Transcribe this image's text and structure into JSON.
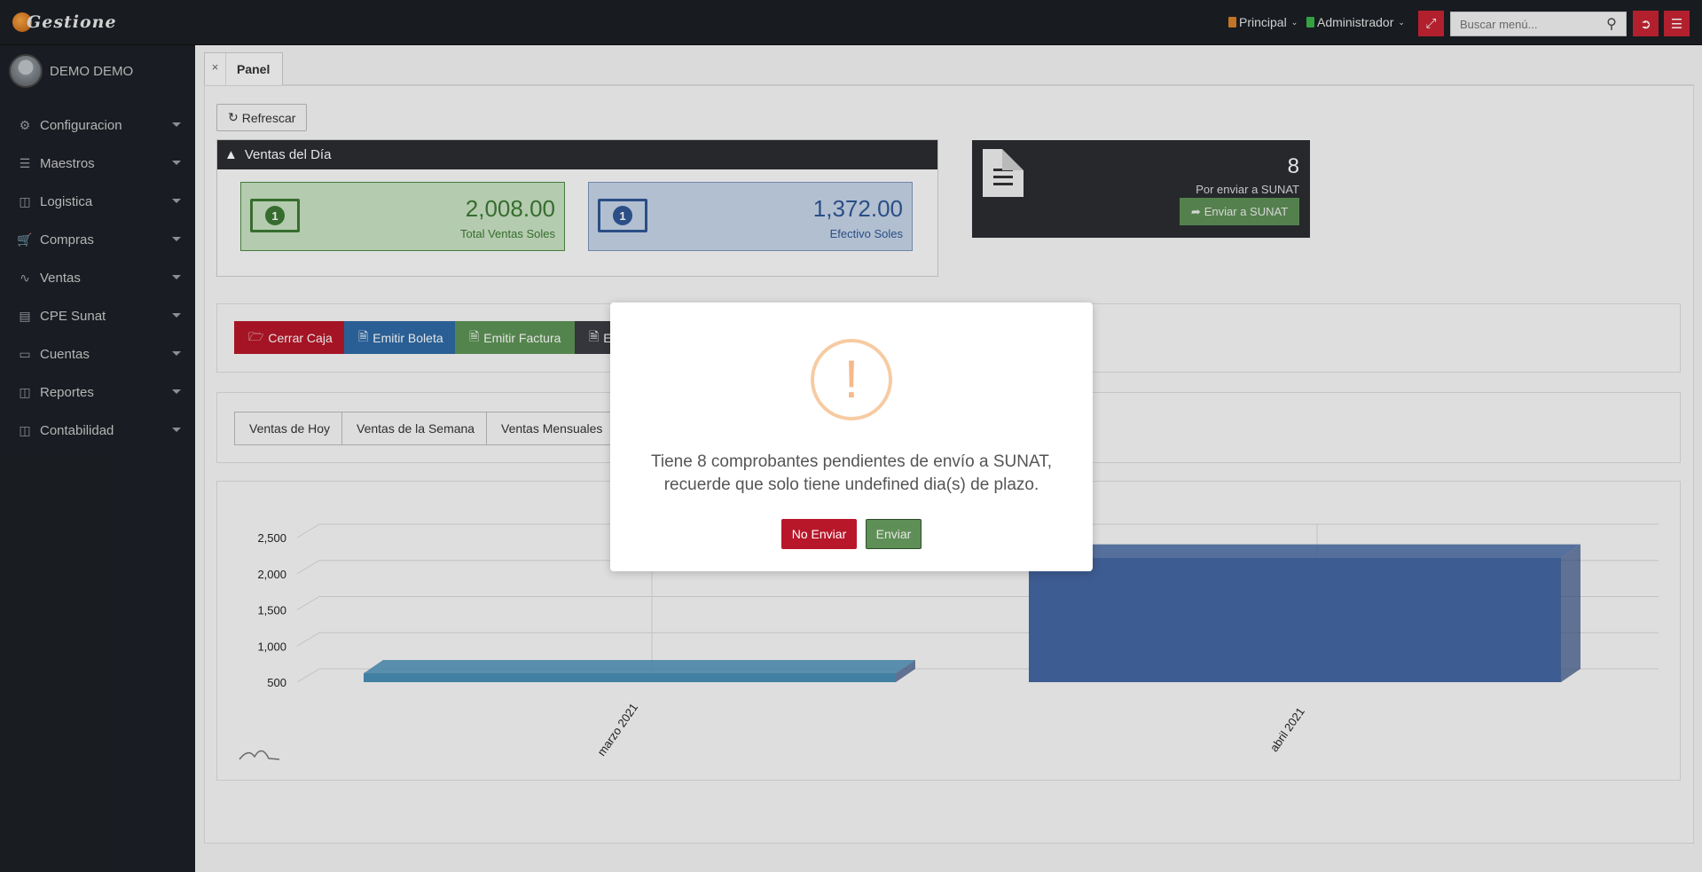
{
  "app": {
    "logo_text": "Gestione"
  },
  "topbar": {
    "menu_principal": "Principal",
    "menu_admin": "Administrador",
    "search_placeholder": "Buscar menú...",
    "colors": {
      "accent_red": "#c72434",
      "bg": "#1b1f24"
    }
  },
  "sidebar": {
    "user_name": "DEMO DEMO",
    "items": [
      {
        "label": "Configuracion",
        "icon": "gears-icon"
      },
      {
        "label": "Maestros",
        "icon": "list-icon"
      },
      {
        "label": "Logistica",
        "icon": "book-icon"
      },
      {
        "label": "Compras",
        "icon": "cart-icon"
      },
      {
        "label": "Ventas",
        "icon": "line-chart-icon"
      },
      {
        "label": "CPE Sunat",
        "icon": "word-file-icon"
      },
      {
        "label": "Cuentas",
        "icon": "cc-icon"
      },
      {
        "label": "Reportes",
        "icon": "book-icon"
      },
      {
        "label": "Contabilidad",
        "icon": "book-icon"
      }
    ]
  },
  "tabs": [
    {
      "label": "Panel",
      "close": "×"
    }
  ],
  "main": {
    "refresh_label": "Refrescar",
    "ventas_dia": {
      "title": "Ventas del Día",
      "total": {
        "value": "2,008.00",
        "label": "Total Ventas Soles"
      },
      "efectivo": {
        "value": "1,372.00",
        "label": "Efectivo Soles"
      }
    },
    "sunat": {
      "count": "8",
      "label": "Por enviar a SUNAT",
      "button": "Enviar a SUNAT"
    },
    "actions": [
      {
        "label": "Cerrar Caja",
        "color": "#c0192c"
      },
      {
        "label": "Emitir Boleta",
        "color": "#2f6aa6"
      },
      {
        "label": "Emitir Factura",
        "color": "#5e9456"
      },
      {
        "label": "E",
        "color": "#3a3d42"
      }
    ],
    "periods": [
      "Ventas de Hoy",
      "Ventas de la Semana",
      "Ventas Mensuales"
    ]
  },
  "chart_data": {
    "type": "bar",
    "categories": [
      "marzo 2021",
      "abril 2021"
    ],
    "values": [
      500,
      2100
    ],
    "yticks": [
      "2,500",
      "2,000",
      "1,500",
      "1,000",
      "500"
    ],
    "ylim": [
      500,
      2500
    ],
    "colors": [
      "#4a8fb6",
      "#4567a2"
    ],
    "grid": true
  },
  "modal": {
    "icon": "!",
    "message_line1": "Tiene 8 comprobantes pendientes de envío a SUNAT,",
    "message_line2": "recuerde que solo tiene undefined dia(s) de plazo.",
    "cancel_label": "No Enviar",
    "confirm_label": "Enviar"
  }
}
